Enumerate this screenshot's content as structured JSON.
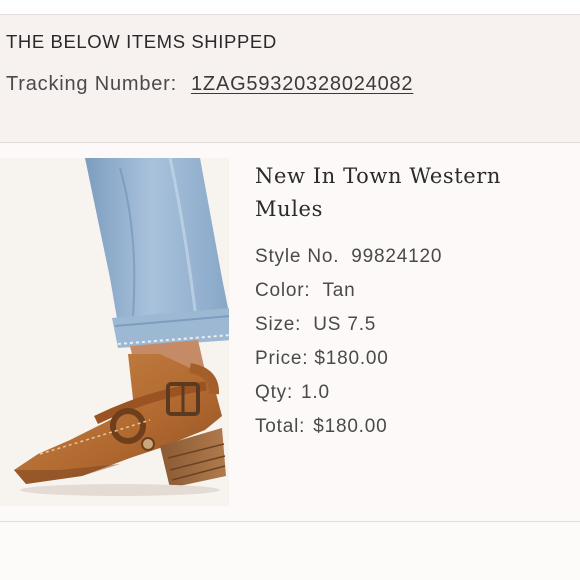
{
  "shipment": {
    "title": "THE BELOW ITEMS SHIPPED",
    "tracking_label": "Tracking Number:",
    "tracking_number": "1ZAG59320328024082"
  },
  "item": {
    "name": "New In Town Western Mules",
    "style_label": "Style No.",
    "style_value": "99824120",
    "color_label": "Color:",
    "color_value": "Tan",
    "size_label": "Size:",
    "size_value": "US 7.5",
    "price_label": "Price:",
    "price_value": "$180.00",
    "qty_label": "Qty:",
    "qty_value": "1.0",
    "total_label": "Total:",
    "total_value": "$180.00",
    "image_icon": "product-photo-boot-icon"
  },
  "colors": {
    "header_bg": "#f7f1ef",
    "page_bg": "#fcf9f8",
    "text": "#4a4a4a",
    "leather": "#b8713a"
  }
}
